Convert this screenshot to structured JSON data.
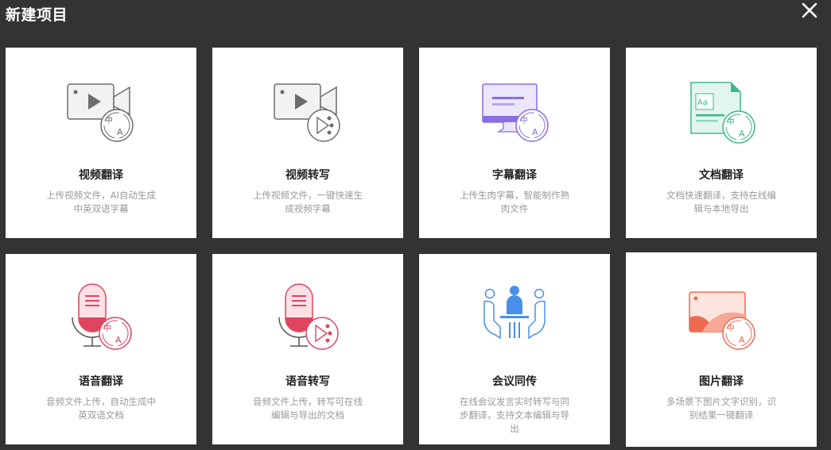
{
  "header": {
    "title": "新建项目"
  },
  "cards": [
    {
      "name": "视频翻译",
      "desc": "上传视频文件，AI自动生成中英双语字幕",
      "icon": "video-translate-icon"
    },
    {
      "name": "视频转写",
      "desc": "上传视频文件，一键快速生成视频字幕",
      "icon": "video-transcribe-icon"
    },
    {
      "name": "字幕翻译",
      "desc": "上传生肉字幕，智能制作熟肉文件",
      "icon": "subtitle-translate-icon"
    },
    {
      "name": "文档翻译",
      "desc": "文档快速翻译，支持在线编辑与本地导出",
      "icon": "document-translate-icon"
    },
    {
      "name": "语音翻译",
      "desc": "音频文件上传，自动生成中英双语文档",
      "icon": "audio-translate-icon"
    },
    {
      "name": "语音转写",
      "desc": "音频文件上传，转写可在线编辑与导出的文档",
      "icon": "audio-transcribe-icon"
    },
    {
      "name": "会议同传",
      "desc": "在线会议发言实时转写与同步翻译，支持文本编辑与导出",
      "icon": "meeting-interpret-icon"
    },
    {
      "name": "图片翻译",
      "desc": "多场景下图片文字识别，识别结果一键翻译",
      "icon": "image-translate-icon"
    }
  ],
  "colors": {
    "background": "#333333",
    "card": "#ffffff",
    "gray_accent": "#6d6d6d",
    "purple_accent": "#8a6fe0",
    "green_accent": "#3bb889",
    "red_accent": "#e0455f",
    "blue_accent": "#4a8fe8",
    "orange_accent": "#ee6a52"
  }
}
